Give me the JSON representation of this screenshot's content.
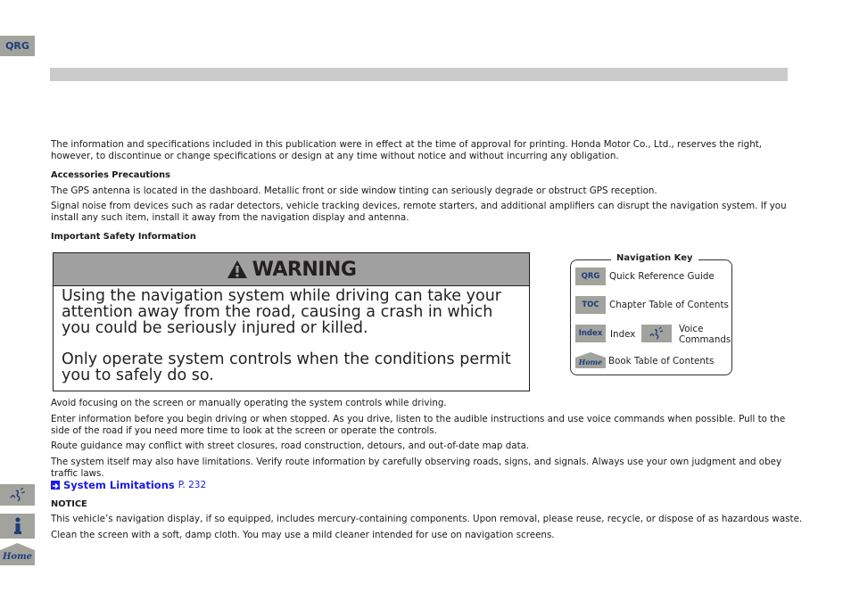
{
  "sidebar": {
    "qrg_label": "QRG",
    "voice_icon": "voice-commands-icon",
    "info_icon": "info-icon",
    "home_label": "Home"
  },
  "intro": {
    "line1": "The information and specifications included in this publication were in effect at the time of approval for printing. Honda Motor Co., Ltd., reserves the right,",
    "line2": "however, to discontinue or change specifications or design at any time without notice and without incurring any obligation."
  },
  "accessories": {
    "heading": "Accessories Precautions",
    "p1": "The GPS antenna is located in the dashboard. Metallic front or side window tinting can seriously degrade or obstruct GPS reception.",
    "p2_line1": "Signal noise from devices such as radar detectors, vehicle tracking devices, remote starters, and additional amplifiers can disrupt the navigation system. If you",
    "p2_line2": "install any such item, install it away from the navigation display and antenna."
  },
  "safety": {
    "heading": "Important Safety Information",
    "warning_title": "WARNING",
    "warning_p1": "Using the navigation system while driving can take your attention away from the road, causing a crash in which you could be seriously injured or killed.",
    "warning_p2": "Only operate system controls when the conditions permit you to safely do so."
  },
  "nav_key": {
    "title": "Navigation Key",
    "qrg_badge": "QRG",
    "qrg_label": "Quick Reference Guide",
    "toc_badge": "TOC",
    "toc_label": "Chapter Table of Contents",
    "index_badge": "Index",
    "index_label": "Index",
    "voice_label_1": "Voice",
    "voice_label_2": "Commands",
    "home_badge": "Home",
    "home_label": "Book Table of Contents"
  },
  "body": {
    "p1": "Avoid focusing on the screen or manually operating the system controls while driving.",
    "p2_line1": "Enter information before you begin driving or when stopped. As you drive, listen to the audible instructions and use voice commands when possible. Pull to the",
    "p2_line2": "side of the road if you need more time to look at the screen or operate the controls.",
    "p3": "Route guidance may conflict with street closures, road construction, detours, and out-of-date map data.",
    "p4_line1": "The system itself may also have limitations. Verify route information by carefully observing roads, signs, and signals. Always use your own judgment and obey",
    "p4_line2": "traffic laws.",
    "link_text": "System Limitations",
    "link_page": "P. 232",
    "notice_heading": "NOTICE",
    "notice_p1": "This vehicle’s navigation display, if so equipped, includes mercury-containing components. Upon removal, please reuse, recycle, or dispose of as hazardous waste.",
    "notice_p2": "Clean the screen with a soft, damp cloth. You may use a mild cleaner intended for use on navigation screens."
  }
}
